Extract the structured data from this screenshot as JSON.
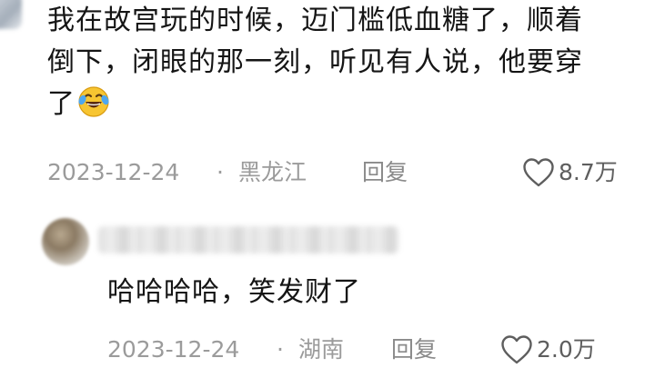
{
  "comment": {
    "lines": [
      "我在故宫玩的时候，迈门槛低血糖了，顺着",
      "倒下，闭眼的那一刻，听见有人说，他要穿",
      "了"
    ],
    "emoji": "laughing-crying-emoji",
    "date": "2023-12-24",
    "separator": "·",
    "location": "黑龙江",
    "reply_label": "回复",
    "likes": "8.7万"
  },
  "reply": {
    "text": "哈哈哈哈，笑发财了",
    "date": "2023-12-24",
    "separator": "·",
    "location": "湖南",
    "reply_label": "回复",
    "likes": "2.0万"
  },
  "colors": {
    "text": "#151515",
    "meta": "#9b9b9b",
    "like": "#5e5e5e",
    "emoji_face": "#f7c531"
  }
}
